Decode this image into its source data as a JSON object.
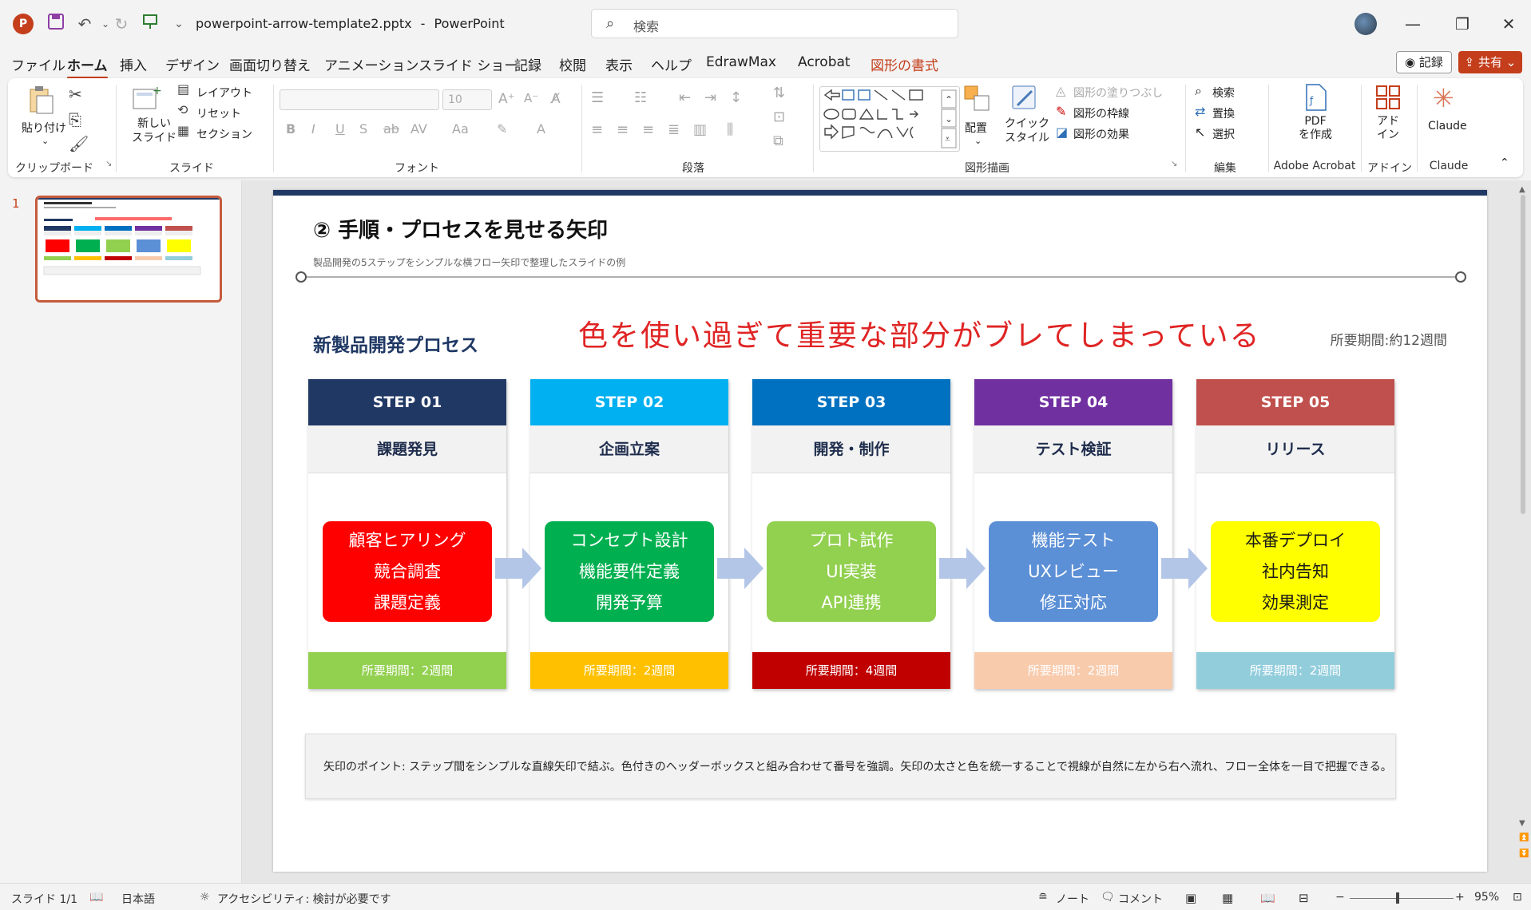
{
  "window": {
    "file_name": "powerpoint-arrow-template2.pptx",
    "app_name": "PowerPoint",
    "separator": "-",
    "search_placeholder": "検索"
  },
  "menu": {
    "tabs": [
      "ファイル",
      "ホーム",
      "挿入",
      "デザイン",
      "画面切り替え",
      "アニメーション",
      "スライド ショー",
      "記録",
      "校閲",
      "表示",
      "ヘルプ",
      "EdrawMax",
      "Acrobat",
      "図形の書式"
    ],
    "active": "ホーム",
    "record_label": "記録",
    "share_label": "共有"
  },
  "ribbon": {
    "clipboard": {
      "label": "クリップボード",
      "paste": "貼り付け"
    },
    "slides": {
      "label": "スライド",
      "new_slide": "新しい\nスライド",
      "layout": "レイアウト",
      "reset": "リセット",
      "section": "セクション"
    },
    "font": {
      "label": "フォント",
      "size": "10"
    },
    "paragraph": {
      "label": "段落"
    },
    "drawing": {
      "label": "図形描画",
      "arrange": "配置",
      "quick_style": "クイック\nスタイル",
      "fill": "図形の塗りつぶし",
      "outline": "図形の枠線",
      "effects": "図形の効果"
    },
    "editing": {
      "label": "編集",
      "find": "検索",
      "replace": "置換",
      "select": "選択"
    },
    "acrobat": {
      "label": "Adobe Acrobat",
      "pdf": "PDF\nを作成"
    },
    "addins": {
      "label": "アドイン",
      "addin": "アド\nイン"
    },
    "claude": {
      "label": "Claude",
      "button": "Claude"
    }
  },
  "thumbnail": {
    "number": "1"
  },
  "slide": {
    "title": "② 手順・プロセスを見せる矢印",
    "subtitle": "製品開発の5ステップをシンプルな横フロー矢印で整理したスライドの例",
    "process_title": "新製品開発プロセス",
    "warning": "色を使い過ぎて重要な部分がブレてしまっている",
    "duration": "所要期間:約12週間",
    "steps": [
      {
        "step": "STEP 01",
        "name": "課題発見",
        "tasks": [
          "顧客ヒアリング",
          "競合調査",
          "課題定義"
        ],
        "footer": "所要期間：2週間",
        "head_color": "#203864",
        "task_color": "#ff0000",
        "task_text_color": "#ffffff",
        "foot_color": "#92d050",
        "foot_text_color": "#ffffff"
      },
      {
        "step": "STEP 02",
        "name": "企画立案",
        "tasks": [
          "コンセプト設計",
          "機能要件定義",
          "開発予算"
        ],
        "footer": "所要期間：2週間",
        "head_color": "#00b0f0",
        "task_color": "#00b050",
        "task_text_color": "#ffffff",
        "foot_color": "#ffc000",
        "foot_text_color": "#ffffff"
      },
      {
        "step": "STEP 03",
        "name": "開発・制作",
        "tasks": [
          "プロト試作",
          "UI実装",
          "API連携"
        ],
        "footer": "所要期間：4週間",
        "head_color": "#0070c0",
        "task_color": "#92d050",
        "task_text_color": "#ffffff",
        "foot_color": "#c00000",
        "foot_text_color": "#ffffff"
      },
      {
        "step": "STEP 04",
        "name": "テスト検証",
        "tasks": [
          "機能テスト",
          "UXレビュー",
          "修正対応"
        ],
        "footer": "所要期間：2週間",
        "head_color": "#7030a0",
        "task_color": "#5b8fd6",
        "task_text_color": "#ffffff",
        "foot_color": "#f8cbad",
        "foot_text_color": "#ffffff"
      },
      {
        "step": "STEP 05",
        "name": "リリース",
        "tasks": [
          "本番デプロイ",
          "社内告知",
          "効果測定"
        ],
        "footer": "所要期間：2週間",
        "head_color": "#c0504d",
        "task_color": "#ffff00",
        "task_text_color": "#1a1a1a",
        "foot_color": "#92cddc",
        "foot_text_color": "#ffffff"
      }
    ],
    "arrow_color": "#b4c6e7",
    "note": "矢印のポイント: ステップ間をシンプルな直線矢印で結ぶ。色付きのヘッダーボックスと組み合わせて番号を強調。矢印の太さと色を統一することで視線が自然に左から右へ流れ、フロー全体を一目で把握できる。"
  },
  "status": {
    "slide": "スライド 1/1",
    "language": "日本語",
    "accessibility": "アクセシビリティ: 検討が必要です",
    "notes": "ノート",
    "comments": "コメント",
    "zoom": "95%"
  },
  "icons": {
    "app": "powerpoint-icon",
    "save": "save-icon",
    "undo": "undo-icon",
    "redo": "redo-icon",
    "search": "search-icon",
    "minimize": "minimize-icon",
    "restore": "restore-icon",
    "close": "close-icon"
  }
}
